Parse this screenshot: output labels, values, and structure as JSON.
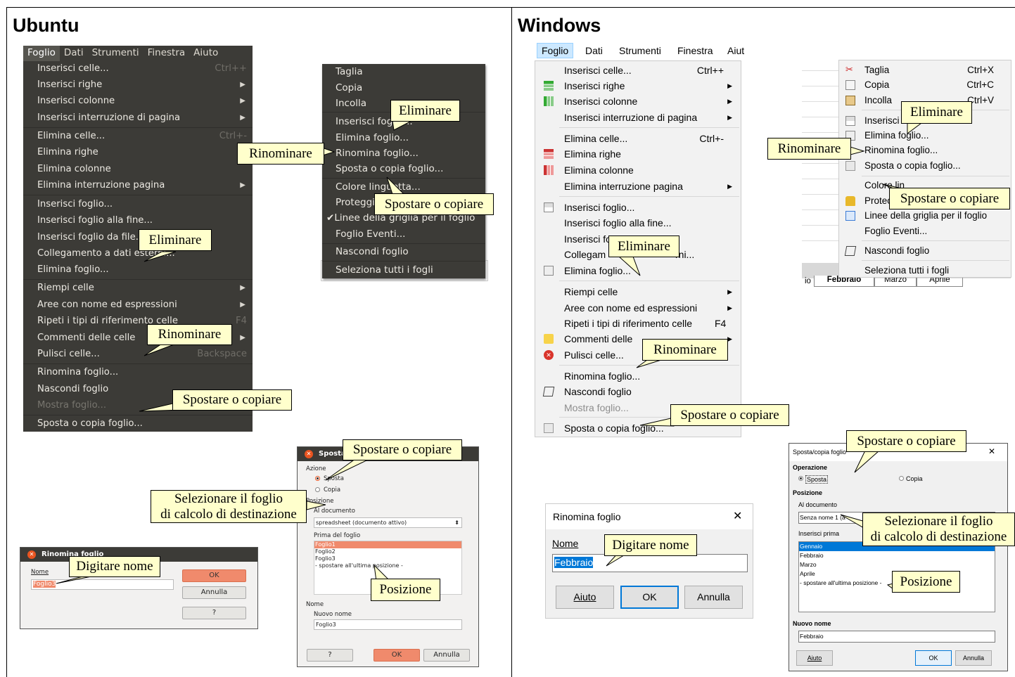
{
  "headings": {
    "ubuntu": "Ubuntu",
    "windows": "Windows"
  },
  "callouts": {
    "eliminare": "Eliminare",
    "rinominare": "Rinominare",
    "spostare": "Spostare o copiare",
    "selezionare_1": "Selezionare il foglio",
    "selezionare_2": "di calcolo di destinazione",
    "digitare": "Digitare nome",
    "posizione": "Posizione"
  },
  "ubuntu": {
    "menubar": [
      "Foglio",
      "Dati",
      "Strumenti",
      "Finestra",
      "Aiuto"
    ],
    "menu": {
      "inserisci_celle": "Inserisci celle...",
      "inserisci_celle_acc": "Ctrl++",
      "inserisci_righe": "Inserisci righe",
      "inserisci_colonne": "Inserisci colonne",
      "inserisci_interruzione": "Inserisci interruzione di pagina",
      "elimina_celle": "Elimina celle...",
      "elimina_celle_acc": "Ctrl+-",
      "elimina_righe": "Elimina righe",
      "elimina_colonne": "Elimina colonne",
      "elimina_interruzione": "Elimina interruzione pagina",
      "inserisci_foglio": "Inserisci foglio...",
      "inserisci_foglio_fine": "Inserisci foglio alla fine...",
      "inserisci_foglio_file": "Inserisci foglio da file...",
      "collegamento": "Collegamento a dati esterni...",
      "elimina_foglio": "Elimina foglio...",
      "riempi": "Riempi celle",
      "aree": "Aree con nome ed espressioni",
      "ripeti": "Ripeti i tipi di riferimento celle",
      "ripeti_acc": "F4",
      "commenti": "Commenti delle celle",
      "pulisci": "Pulisci celle...",
      "pulisci_acc": "Backspace",
      "rinomina": "Rinomina foglio...",
      "nascondi": "Nascondi foglio",
      "mostra": "Mostra foglio...",
      "sposta": "Sposta o copia foglio..."
    },
    "ctx": {
      "taglia": "Taglia",
      "copia": "Copia",
      "incolla": "Incolla",
      "inserisci_foglio": "Inserisci foglio...",
      "elimina": "Elimina foglio...",
      "rinomina": "Rinomina foglio...",
      "sposta": "Sposta o copia foglio...",
      "colore": "Colore linguetta...",
      "proteggi": "Proteggi foglio...",
      "linee": "Linee della griglia per il foglio",
      "eventi": "Foglio Eventi...",
      "nascondi": "Nascondi foglio",
      "seleziona": "Seleziona tutti i fogli"
    },
    "rename_dialog": {
      "title": "Rinomina foglio",
      "label": "Nome",
      "value": "Foglio3",
      "ok": "OK",
      "cancel": "Annulla",
      "help": "?"
    },
    "move_dialog": {
      "title": "Sposta/copia foglio",
      "azione": "Azione",
      "sposta": "Sposta",
      "copia": "Copia",
      "posizione": "Posizione",
      "al_documento": "Al documento",
      "documento": "spreadsheet (documento attivo)",
      "prima_del": "Prima del foglio",
      "fogli": [
        "Foglio1",
        "Foglio2",
        "Foglio3",
        "- spostare all'ultima posizione -"
      ],
      "nome": "Nome",
      "nuovo_nome": "Nuovo nome",
      "nuovo_val": "Foglio3",
      "help": "?",
      "ok": "OK",
      "cancel": "Annulla"
    }
  },
  "windows": {
    "menubar": [
      "Foglio",
      "Dati",
      "Strumenti",
      "Finestra",
      "Aiut"
    ],
    "menu": {
      "inserisci_celle": "Inserisci celle...",
      "inserisci_celle_acc": "Ctrl++",
      "inserisci_righe": "Inserisci righe",
      "inserisci_colonne": "Inserisci colonne",
      "inserisci_interruzione": "Inserisci interruzione di pagina",
      "elimina_celle": "Elimina celle...",
      "elimina_celle_acc": "Ctrl+-",
      "elimina_righe": "Elimina righe",
      "elimina_colonne": "Elimina colonne",
      "elimina_interruzione": "Elimina interruzione pagina",
      "inserisci_foglio": "Inserisci foglio...",
      "inserisci_foglio_fine": "Inserisci foglio alla fine...",
      "inserisci_foglio_file": "Inserisci fo",
      "collegamento": "Collegam",
      "collegamento_tail": "rni...",
      "elimina_foglio": "Elimina foglio...",
      "riempi": "Riempi celle",
      "aree": "Aree con nome ed espressioni",
      "ripeti": "Ripeti i tipi di riferimento celle",
      "ripeti_acc": "F4",
      "commenti": "Commenti delle",
      "pulisci": "Pulisci celle...",
      "rinomina": "Rinomina foglio...",
      "nascondi": "Nascondi foglio",
      "mostra": "Mostra foglio...",
      "sposta": "Sposta o copia foglio..."
    },
    "ctx": {
      "taglia": "Taglia",
      "taglia_acc": "Ctrl+X",
      "copia": "Copia",
      "copia_acc": "Ctrl+C",
      "incolla": "Incolla",
      "incolla_acc": "Ctrl+V",
      "inserisci": "Inserisci",
      "elimina": "Elimina foglio...",
      "rinomina": "Rinomina foglio...",
      "sposta": "Sposta o copia foglio...",
      "colore": "Colore lin",
      "proteggi": "Protec",
      "linee": "Linee della griglia per il foglio",
      "eventi": "Foglio Eventi...",
      "nascondi": "Nascondi foglio",
      "seleziona": "Seleziona tutti i fogli"
    },
    "tabs": [
      "io",
      "Febbraio",
      "Marzo",
      "Aprile"
    ],
    "rename_dialog": {
      "title": "Rinomina foglio",
      "label": "Nome",
      "value": "Febbraio",
      "help": "Aiuto",
      "ok": "OK",
      "cancel": "Annulla",
      "close": "✕"
    },
    "move_dialog": {
      "title": "Sposta/copia foglio",
      "close": "✕",
      "operazione": "Operazione",
      "sposta": "Sposta",
      "copia": "Copia",
      "posizione": "Posizione",
      "al_documento": "Al documento",
      "documento": "Senza nome 1 (a",
      "inserisci_prima": "Inserisci prima",
      "fogli": [
        "Gennaio",
        "Febbraio",
        "Marzo",
        "Aprile",
        "- spostare all'ultima posizione -"
      ],
      "nuovo_nome": "Nuovo nome",
      "nuovo_val": "Febbraio",
      "help": "Aiuto",
      "ok": "OK",
      "cancel": "Annulla"
    }
  }
}
